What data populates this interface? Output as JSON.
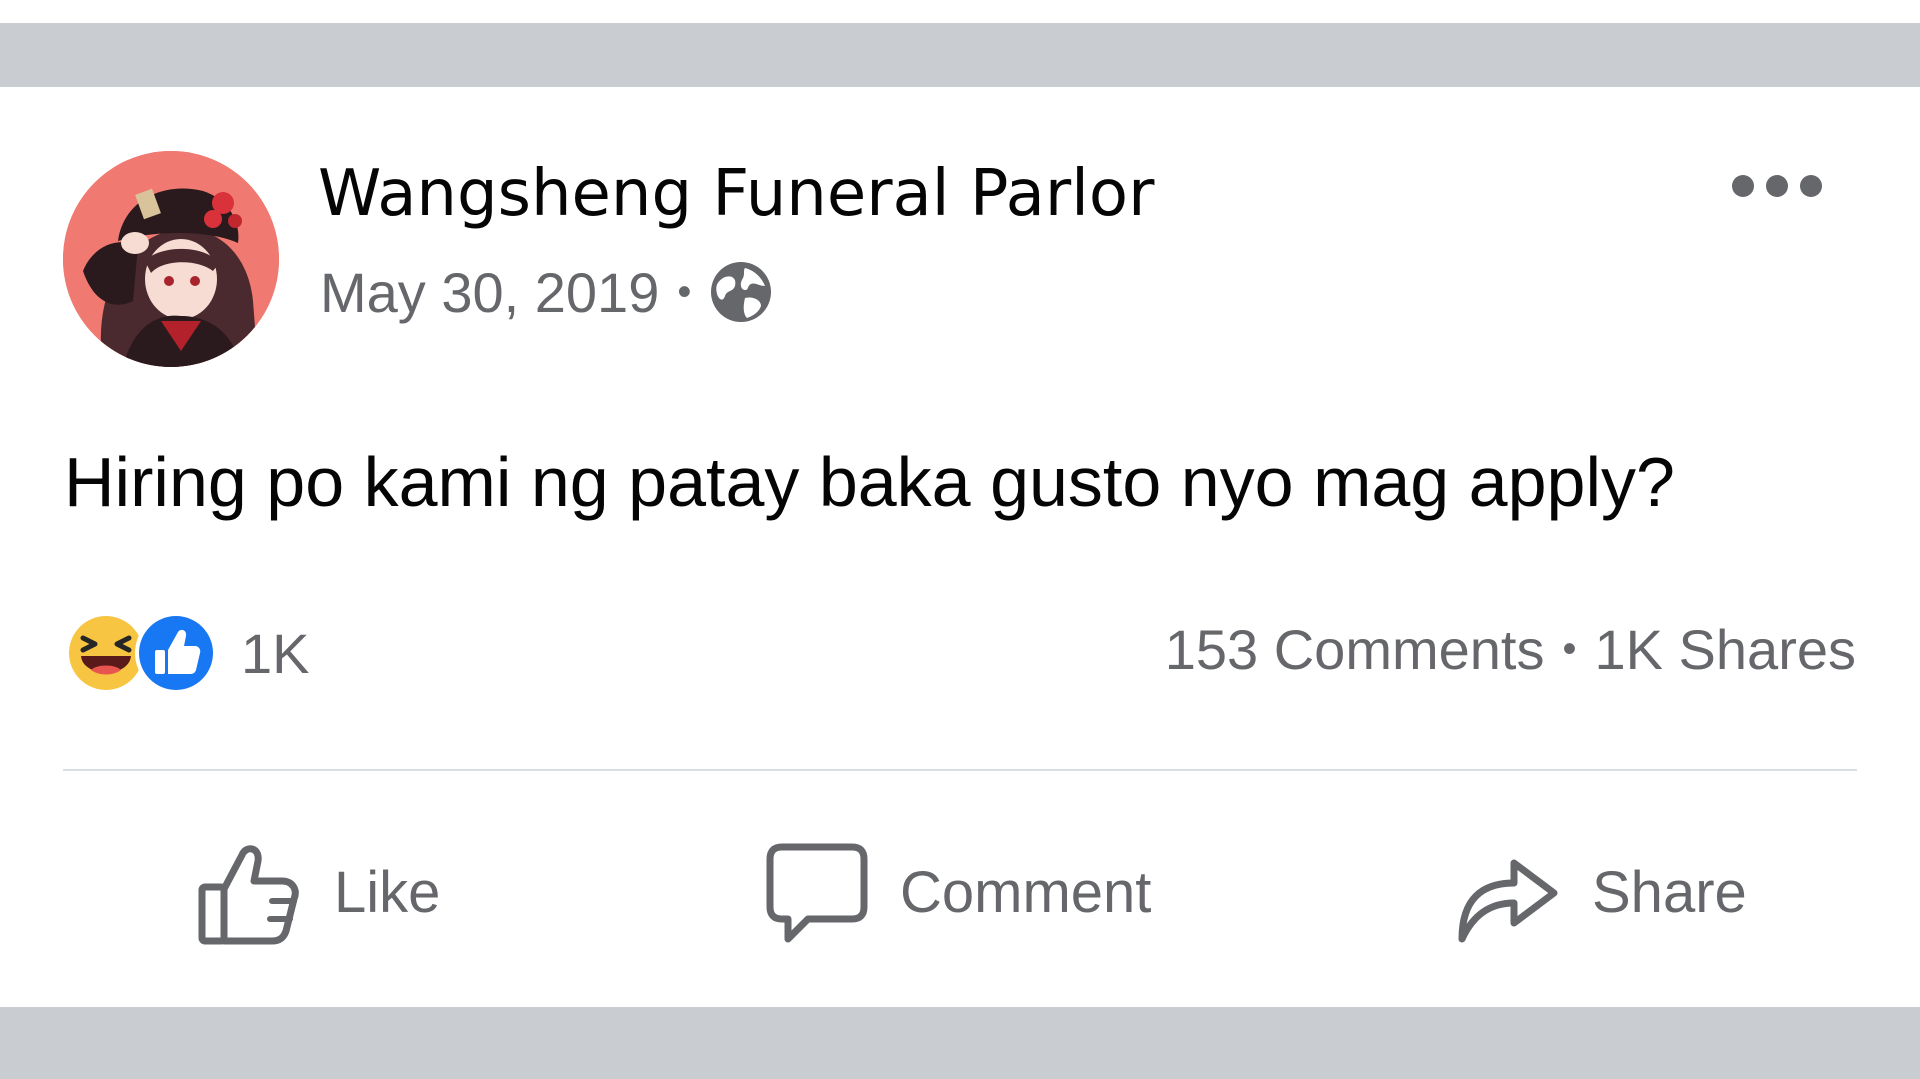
{
  "post": {
    "author": "Wangsheng Funeral Parlor",
    "date": "May 30, 2019",
    "separator": "•",
    "audience_icon": "globe-icon",
    "text": "Hiring po kami ng patay baka gusto nyo mag apply?"
  },
  "stats": {
    "reactions": [
      "haha-icon",
      "like-icon"
    ],
    "reaction_count": "1K",
    "comments": "153 Comments",
    "separator": "•",
    "shares": "1K Shares"
  },
  "actions": {
    "like_label": "Like",
    "comment_label": "Comment",
    "share_label": "Share"
  },
  "colors": {
    "text_primary": "#050505",
    "text_secondary": "#65676b",
    "like_blue": "#1877f2",
    "haha_yellow": "#f7c541",
    "avatar_bg": "#f07a72",
    "frame_gray": "#c9ccd1"
  }
}
